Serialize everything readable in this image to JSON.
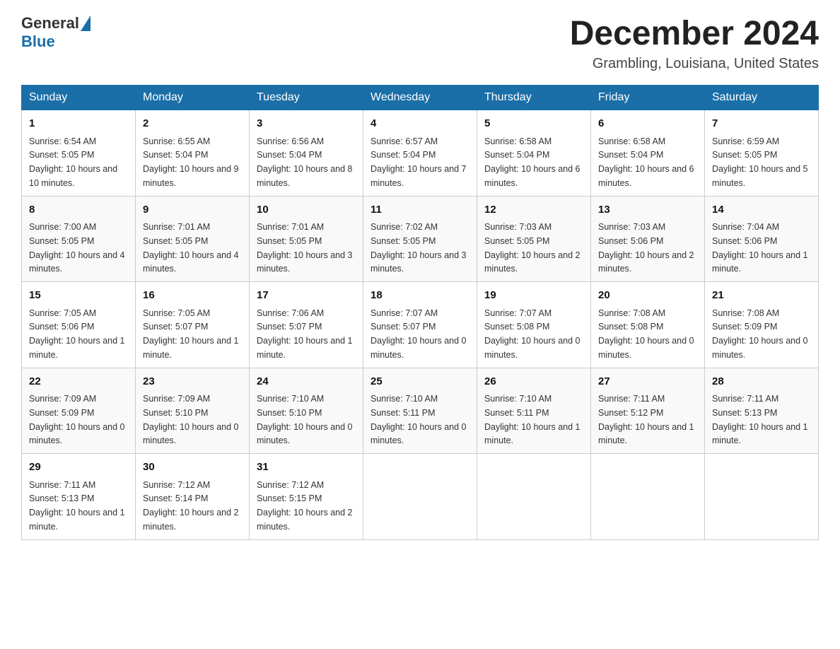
{
  "logo": {
    "general": "General",
    "blue": "Blue"
  },
  "title": {
    "month_year": "December 2024",
    "location": "Grambling, Louisiana, United States"
  },
  "weekdays": [
    "Sunday",
    "Monday",
    "Tuesday",
    "Wednesday",
    "Thursday",
    "Friday",
    "Saturday"
  ],
  "weeks": [
    [
      {
        "day": "1",
        "sunrise": "6:54 AM",
        "sunset": "5:05 PM",
        "daylight": "10 hours and 10 minutes."
      },
      {
        "day": "2",
        "sunrise": "6:55 AM",
        "sunset": "5:04 PM",
        "daylight": "10 hours and 9 minutes."
      },
      {
        "day": "3",
        "sunrise": "6:56 AM",
        "sunset": "5:04 PM",
        "daylight": "10 hours and 8 minutes."
      },
      {
        "day": "4",
        "sunrise": "6:57 AM",
        "sunset": "5:04 PM",
        "daylight": "10 hours and 7 minutes."
      },
      {
        "day": "5",
        "sunrise": "6:58 AM",
        "sunset": "5:04 PM",
        "daylight": "10 hours and 6 minutes."
      },
      {
        "day": "6",
        "sunrise": "6:58 AM",
        "sunset": "5:04 PM",
        "daylight": "10 hours and 6 minutes."
      },
      {
        "day": "7",
        "sunrise": "6:59 AM",
        "sunset": "5:05 PM",
        "daylight": "10 hours and 5 minutes."
      }
    ],
    [
      {
        "day": "8",
        "sunrise": "7:00 AM",
        "sunset": "5:05 PM",
        "daylight": "10 hours and 4 minutes."
      },
      {
        "day": "9",
        "sunrise": "7:01 AM",
        "sunset": "5:05 PM",
        "daylight": "10 hours and 4 minutes."
      },
      {
        "day": "10",
        "sunrise": "7:01 AM",
        "sunset": "5:05 PM",
        "daylight": "10 hours and 3 minutes."
      },
      {
        "day": "11",
        "sunrise": "7:02 AM",
        "sunset": "5:05 PM",
        "daylight": "10 hours and 3 minutes."
      },
      {
        "day": "12",
        "sunrise": "7:03 AM",
        "sunset": "5:05 PM",
        "daylight": "10 hours and 2 minutes."
      },
      {
        "day": "13",
        "sunrise": "7:03 AM",
        "sunset": "5:06 PM",
        "daylight": "10 hours and 2 minutes."
      },
      {
        "day": "14",
        "sunrise": "7:04 AM",
        "sunset": "5:06 PM",
        "daylight": "10 hours and 1 minute."
      }
    ],
    [
      {
        "day": "15",
        "sunrise": "7:05 AM",
        "sunset": "5:06 PM",
        "daylight": "10 hours and 1 minute."
      },
      {
        "day": "16",
        "sunrise": "7:05 AM",
        "sunset": "5:07 PM",
        "daylight": "10 hours and 1 minute."
      },
      {
        "day": "17",
        "sunrise": "7:06 AM",
        "sunset": "5:07 PM",
        "daylight": "10 hours and 1 minute."
      },
      {
        "day": "18",
        "sunrise": "7:07 AM",
        "sunset": "5:07 PM",
        "daylight": "10 hours and 0 minutes."
      },
      {
        "day": "19",
        "sunrise": "7:07 AM",
        "sunset": "5:08 PM",
        "daylight": "10 hours and 0 minutes."
      },
      {
        "day": "20",
        "sunrise": "7:08 AM",
        "sunset": "5:08 PM",
        "daylight": "10 hours and 0 minutes."
      },
      {
        "day": "21",
        "sunrise": "7:08 AM",
        "sunset": "5:09 PM",
        "daylight": "10 hours and 0 minutes."
      }
    ],
    [
      {
        "day": "22",
        "sunrise": "7:09 AM",
        "sunset": "5:09 PM",
        "daylight": "10 hours and 0 minutes."
      },
      {
        "day": "23",
        "sunrise": "7:09 AM",
        "sunset": "5:10 PM",
        "daylight": "10 hours and 0 minutes."
      },
      {
        "day": "24",
        "sunrise": "7:10 AM",
        "sunset": "5:10 PM",
        "daylight": "10 hours and 0 minutes."
      },
      {
        "day": "25",
        "sunrise": "7:10 AM",
        "sunset": "5:11 PM",
        "daylight": "10 hours and 0 minutes."
      },
      {
        "day": "26",
        "sunrise": "7:10 AM",
        "sunset": "5:11 PM",
        "daylight": "10 hours and 1 minute."
      },
      {
        "day": "27",
        "sunrise": "7:11 AM",
        "sunset": "5:12 PM",
        "daylight": "10 hours and 1 minute."
      },
      {
        "day": "28",
        "sunrise": "7:11 AM",
        "sunset": "5:13 PM",
        "daylight": "10 hours and 1 minute."
      }
    ],
    [
      {
        "day": "29",
        "sunrise": "7:11 AM",
        "sunset": "5:13 PM",
        "daylight": "10 hours and 1 minute."
      },
      {
        "day": "30",
        "sunrise": "7:12 AM",
        "sunset": "5:14 PM",
        "daylight": "10 hours and 2 minutes."
      },
      {
        "day": "31",
        "sunrise": "7:12 AM",
        "sunset": "5:15 PM",
        "daylight": "10 hours and 2 minutes."
      },
      null,
      null,
      null,
      null
    ]
  ],
  "labels": {
    "sunrise": "Sunrise:",
    "sunset": "Sunset:",
    "daylight": "Daylight:"
  }
}
